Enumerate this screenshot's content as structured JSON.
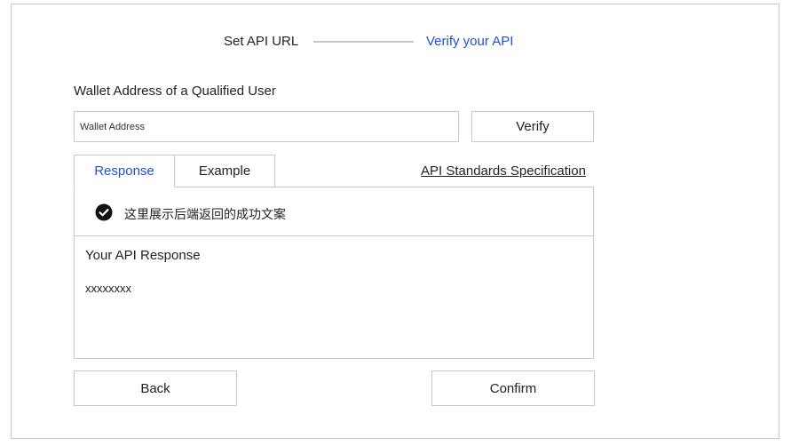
{
  "steps": {
    "step1_label": "Set API URL",
    "step2_label": "Verify your API"
  },
  "form": {
    "label": "Wallet Address of a Qualified User",
    "wallet_placeholder": "Wallet Address",
    "wallet_value": "",
    "verify_label": "Verify"
  },
  "tabs": [
    {
      "label": "Response",
      "active": true
    },
    {
      "label": "Example",
      "active": false
    }
  ],
  "spec_link": "API Standards Specification",
  "result": {
    "status_icon": "check-circle-icon",
    "success_message": "这里展示后端返回的成功文案",
    "response_title": "Your API Response",
    "response_value": "xxxxxxxx"
  },
  "footer": {
    "back_label": "Back",
    "confirm_label": "Confirm"
  },
  "colors": {
    "accent": "#1f4fd8",
    "border": "#c8c8c8",
    "text": "#222222"
  }
}
